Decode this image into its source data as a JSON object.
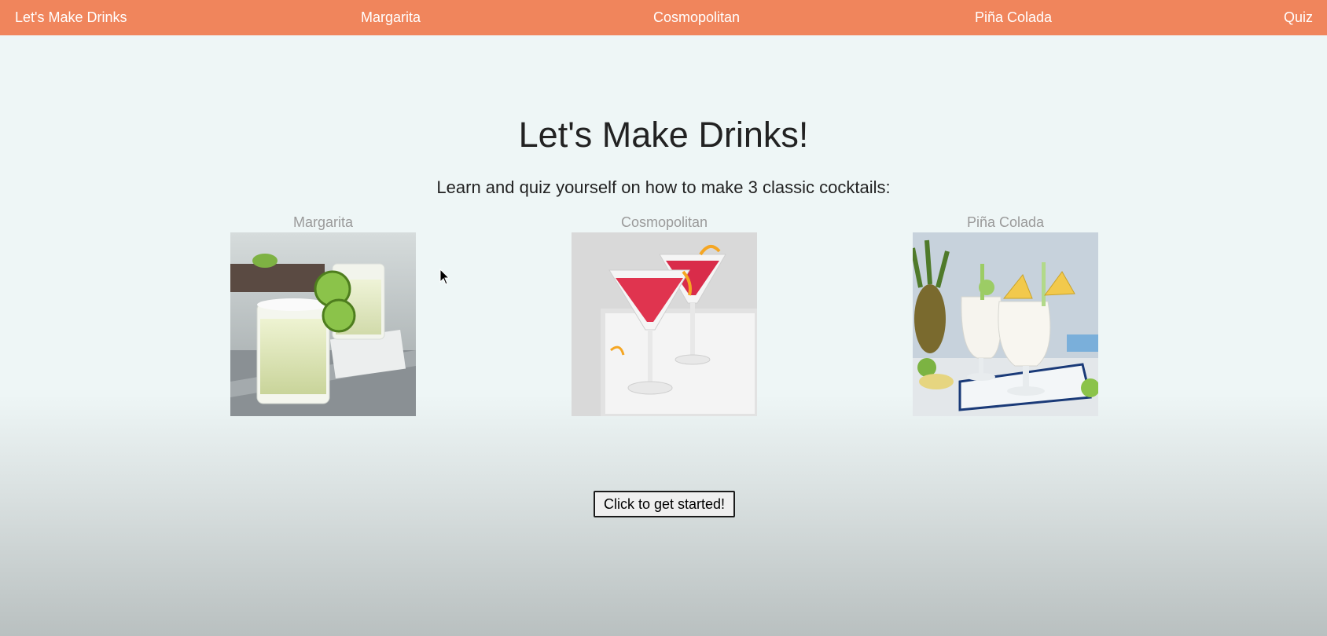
{
  "nav": {
    "brand": "Let's Make Drinks",
    "links": [
      "Margarita",
      "Cosmopolitan",
      "Piña Colada",
      "Quiz"
    ]
  },
  "hero": {
    "title": "Let's Make Drinks!",
    "subtitle": "Learn and quiz yourself on how to make 3 classic cocktails:"
  },
  "cards": [
    {
      "label": "Margarita",
      "image": "margarita-photo"
    },
    {
      "label": "Cosmopolitan",
      "image": "cosmopolitan-photo"
    },
    {
      "label": "Piña Colada",
      "image": "pina-colada-photo"
    }
  ],
  "start_button": {
    "label": "Click to get started!"
  },
  "colors": {
    "navbar": "#f0855c",
    "nav_text": "#ffffff",
    "card_label": "#9a9a9a"
  }
}
